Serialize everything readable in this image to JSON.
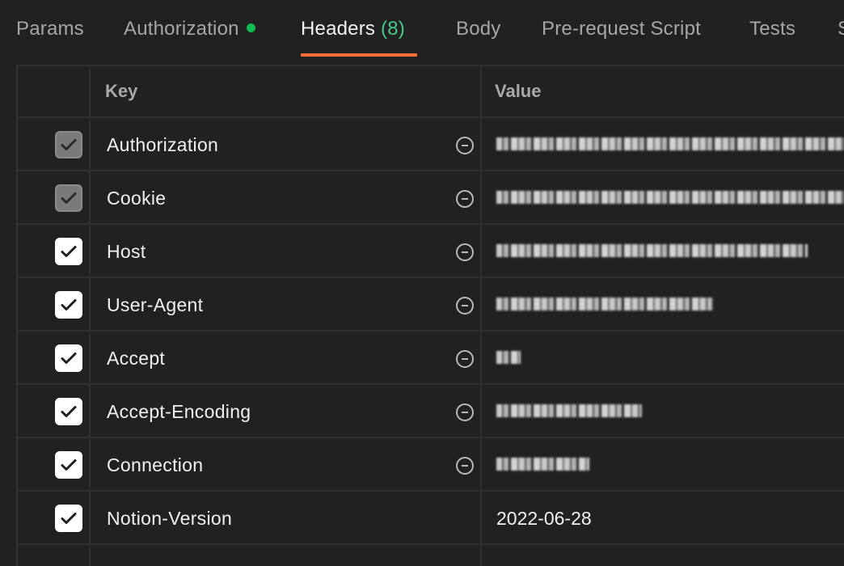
{
  "tabs": [
    {
      "label": "Params"
    },
    {
      "label": "Authorization"
    },
    {
      "label": "Headers",
      "count": "(8)"
    },
    {
      "label": "Body"
    },
    {
      "label": "Pre-request Script"
    },
    {
      "label": "Tests"
    },
    {
      "label": "S"
    }
  ],
  "table": {
    "key_header": "Key",
    "value_header": "Value"
  },
  "rows": [
    {
      "key": "Authorization",
      "value": ""
    },
    {
      "key": "Cookie",
      "value": ""
    },
    {
      "key": "Host",
      "value": ""
    },
    {
      "key": "User-Agent",
      "value": ""
    },
    {
      "key": "Accept",
      "value": ""
    },
    {
      "key": "Accept-Encoding",
      "value": ""
    },
    {
      "key": "Connection",
      "value": ""
    },
    {
      "key": "Notion-Version",
      "value": "2022-06-28"
    }
  ],
  "colors": {
    "accent": "#ff6c37",
    "auth_dot": "#0cbb52",
    "count": "#48c98a",
    "background": "#212121"
  }
}
